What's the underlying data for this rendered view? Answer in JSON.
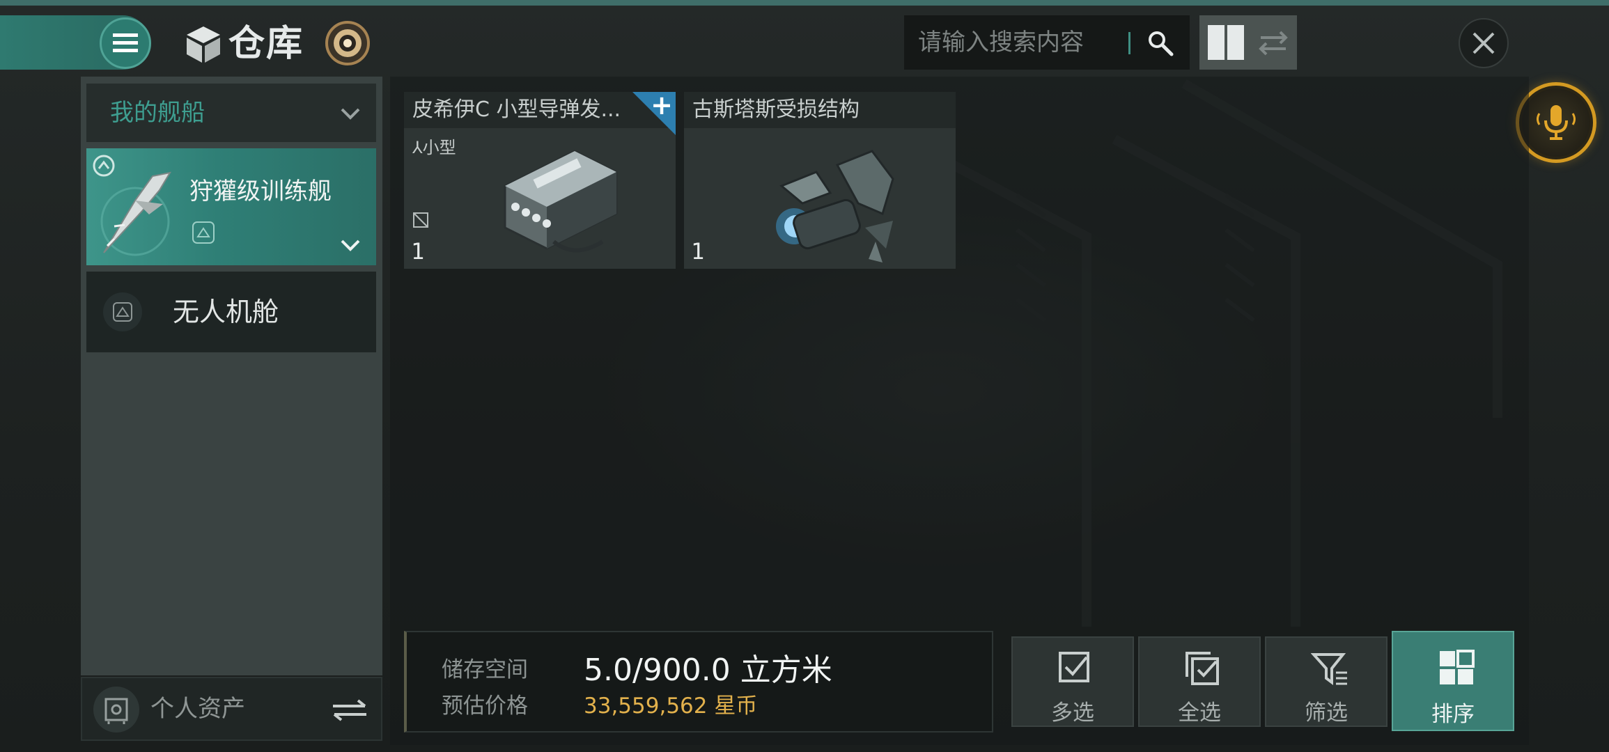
{
  "header": {
    "title": "仓库",
    "menu_icon": "hamburger-menu-icon",
    "search": {
      "placeholder": "请输入搜索内容",
      "value": ""
    }
  },
  "sidebar": {
    "fleet_dropdown": "我的舰船",
    "ship": {
      "name": "狩獾级训练舰"
    },
    "drone_bay": "无人机舱",
    "personal_assets": "个人资产"
  },
  "items": [
    {
      "name": "皮希伊C 小型导弹发...",
      "size_tag": "小型",
      "quantity": "1",
      "has_plus": true
    },
    {
      "name": "古斯塔斯受损结构",
      "quantity": "1"
    }
  ],
  "footer": {
    "storage_label": "储存空间",
    "storage_value": "5.0/900.0 立方米",
    "price_label": "预估价格",
    "price_value": "33,559,562 星币",
    "buttons": {
      "multi_select": "多选",
      "select_all": "全选",
      "filter": "筛选",
      "sort": "排序"
    }
  },
  "colors": {
    "accent_teal": "#2f7a70",
    "gold": "#d49a22",
    "price_gold": "#e2b14c"
  }
}
